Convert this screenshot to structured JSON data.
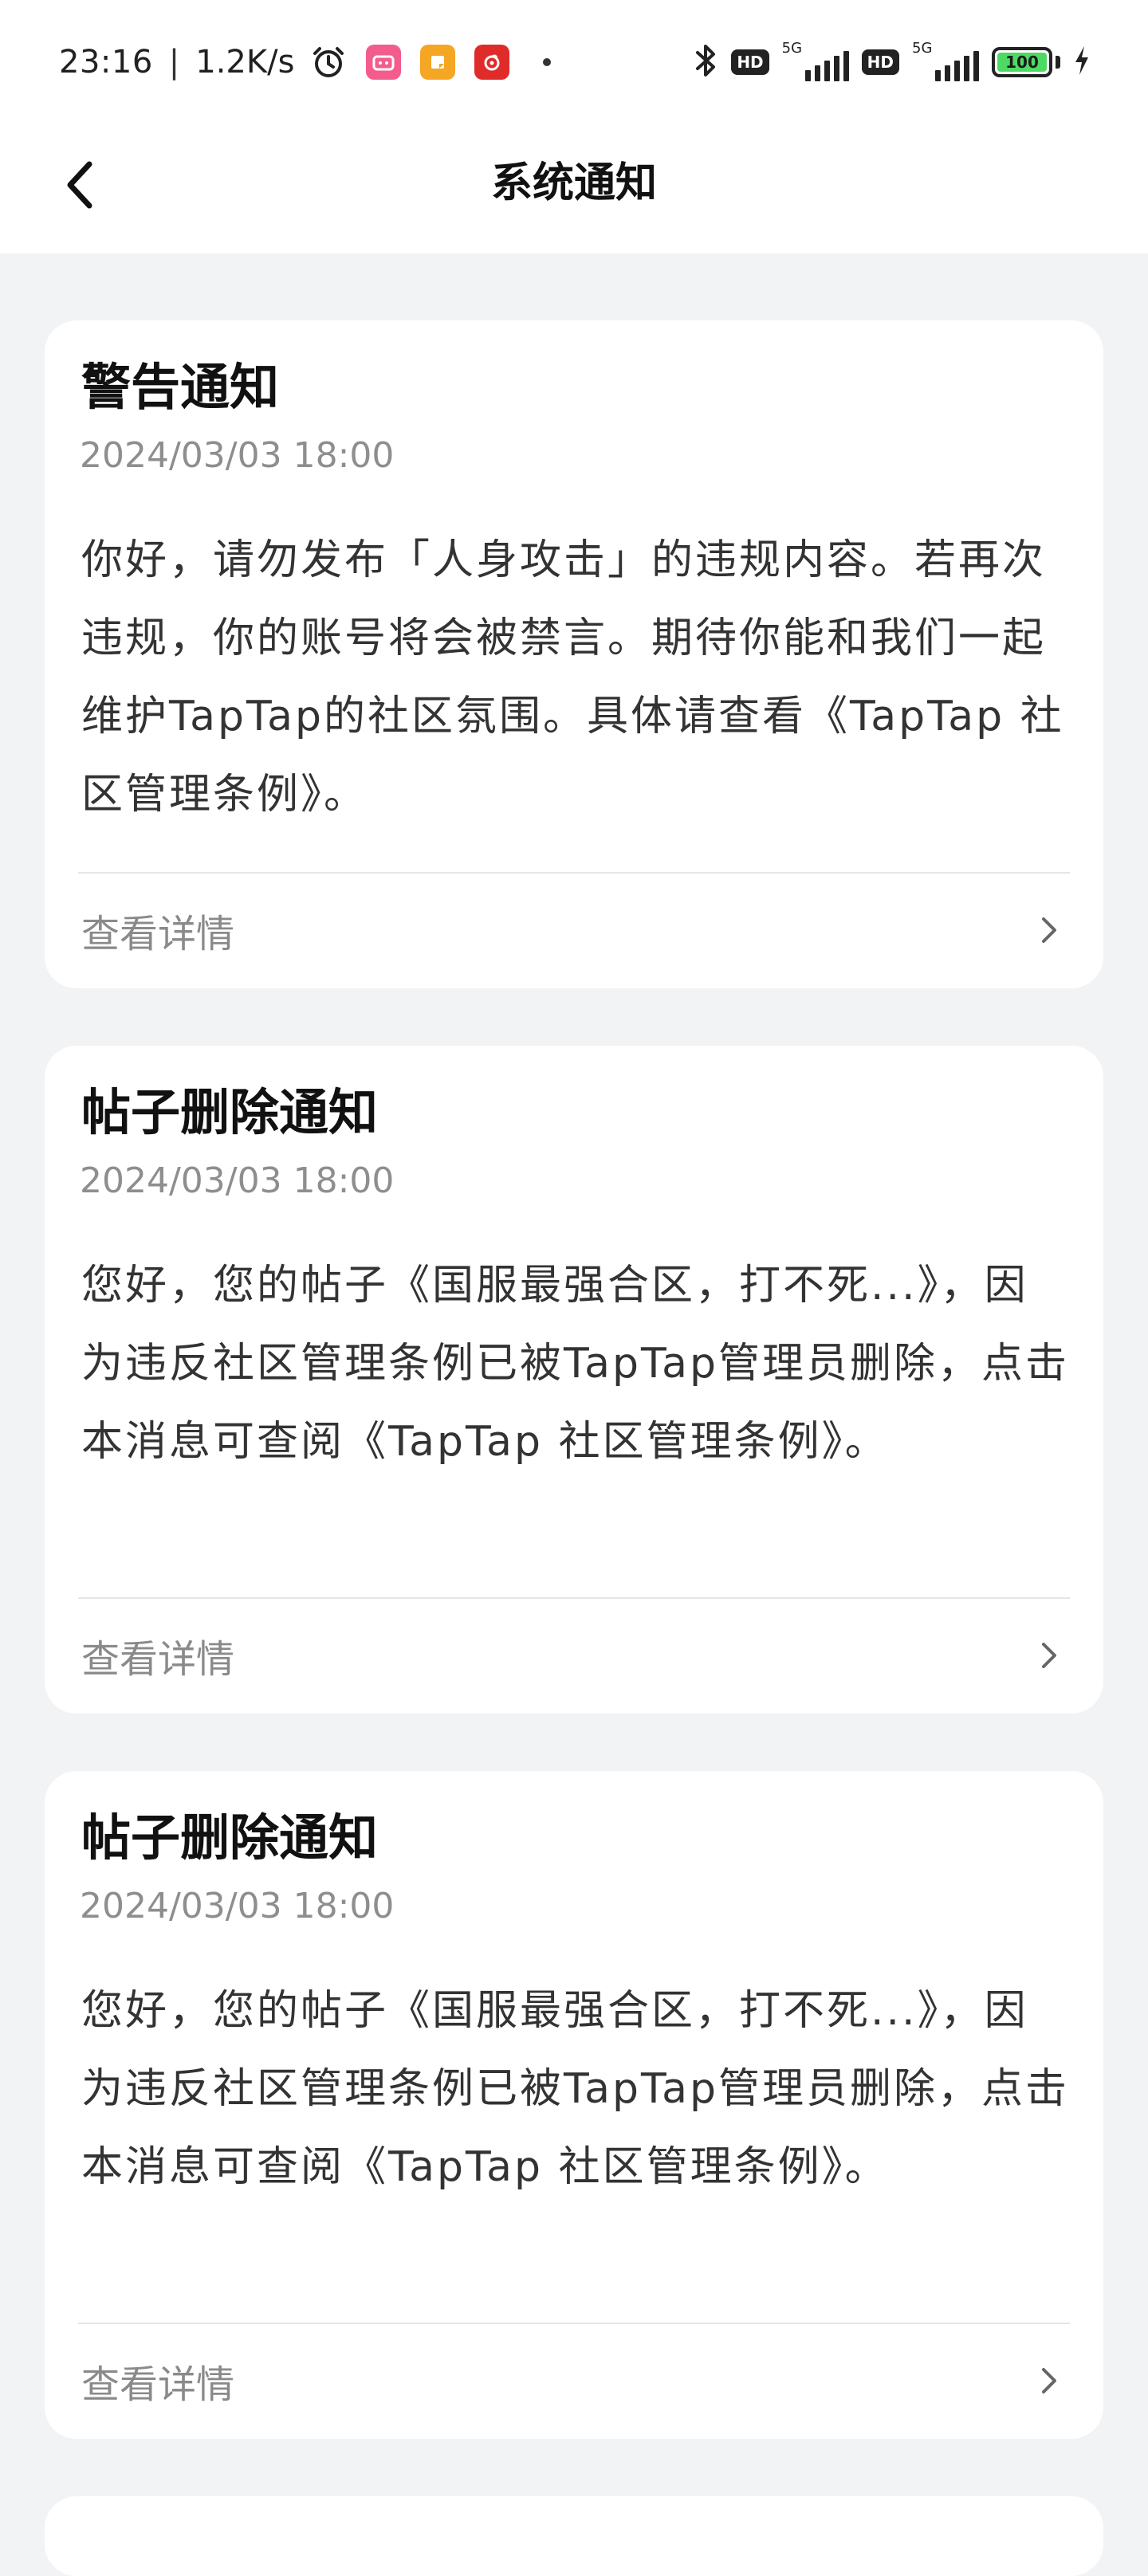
{
  "status_bar": {
    "time": "23:16",
    "separator": "|",
    "net_speed": "1.2K/s",
    "battery": "100",
    "network_badge_1": "HD",
    "network_label_1": "5G",
    "network_badge_2": "HD",
    "network_label_2": "5G",
    "icons": [
      "alarm-icon",
      "bilibili-app-icon",
      "notes-app-icon",
      "netease-music-app-icon",
      "bluetooth-icon",
      "charging-icon"
    ]
  },
  "nav": {
    "title": "系统通知",
    "back_icon": "chevron-left-icon"
  },
  "notifications": [
    {
      "title": "警告通知",
      "date": "2024/03/03  18:00",
      "body": "你好，请勿发布「人身攻击」的违规内容。若再次违规，你的账号将会被禁言。期待你能和我们一起维护TapTap的社区氛围。具体请查看《TapTap 社区管理条例》。",
      "action": "查看详情"
    },
    {
      "title": "帖子删除通知",
      "date": "2024/03/03  18:00",
      "body": "您好，您的帖子《国服最强合区，打不死...》，因为违反社区管理条例已被TapTap管理员删除，点击本消息可查阅《TapTap 社区管理条例》。",
      "action": "查看详情"
    },
    {
      "title": "帖子删除通知",
      "date": "2024/03/03  18:00",
      "body": "您好，您的帖子《国服最强合区，打不死...》，因为违反社区管理条例已被TapTap管理员删除，点击本消息可查阅《TapTap 社区管理条例》。",
      "action": "查看详情"
    }
  ],
  "colors": {
    "page_bg": "#f2f3f5",
    "card_bg": "#ffffff",
    "battery_green": "#4cd964",
    "secondary_text": "#8e8e8e"
  }
}
